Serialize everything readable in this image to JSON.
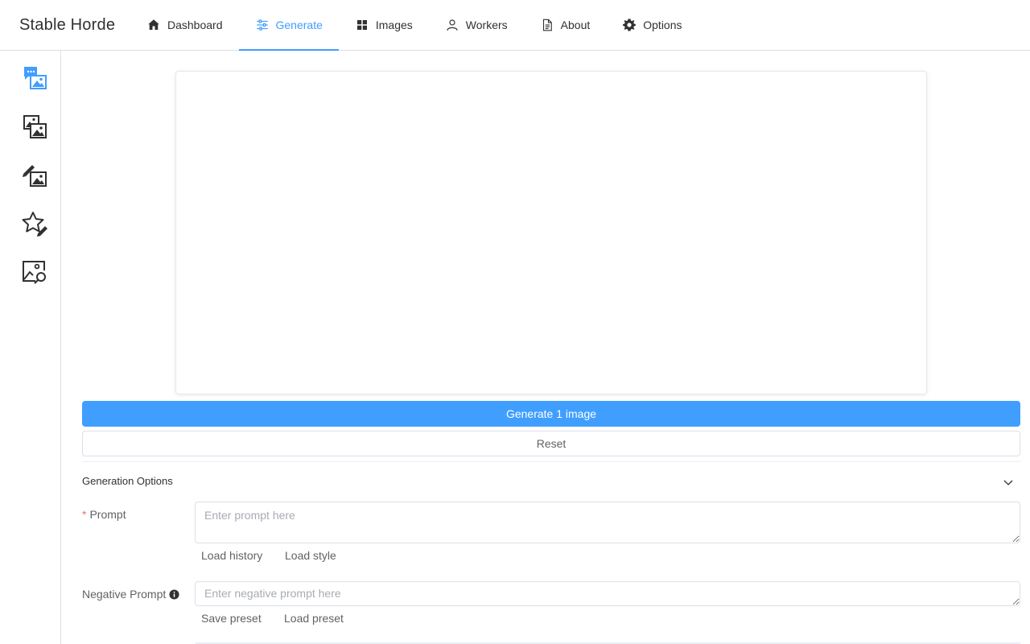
{
  "app": {
    "title": "Stable Horde"
  },
  "nav": {
    "items": [
      {
        "label": "Dashboard",
        "icon": "home-icon"
      },
      {
        "label": "Generate",
        "icon": "sliders-icon",
        "active": true
      },
      {
        "label": "Images",
        "icon": "grid-icon"
      },
      {
        "label": "Workers",
        "icon": "user-icon"
      },
      {
        "label": "About",
        "icon": "document-icon"
      },
      {
        "label": "Options",
        "icon": "gear-icon"
      }
    ]
  },
  "sidebar": {
    "items": [
      {
        "name": "text-to-image",
        "icon": "chat-image-icon",
        "active": true
      },
      {
        "name": "image-to-image",
        "icon": "images-icon"
      },
      {
        "name": "inpainting",
        "icon": "brush-image-icon"
      },
      {
        "name": "rate",
        "icon": "star-edit-icon"
      },
      {
        "name": "interrogation",
        "icon": "image-search-icon"
      }
    ]
  },
  "actions": {
    "generate_label": "Generate 1 image",
    "reset_label": "Reset"
  },
  "options": {
    "title": "Generation Options",
    "prompt": {
      "label": "Prompt",
      "required_mark": "*",
      "placeholder": "Enter prompt here",
      "load_history": "Load history",
      "load_style": "Load style"
    },
    "negative_prompt": {
      "label": "Negative Prompt",
      "placeholder": "Enter negative prompt here",
      "save_preset": "Save preset",
      "load_preset": "Load preset"
    }
  },
  "colors": {
    "accent": "#409eff",
    "required": "#f56c6c",
    "border": "#dcdfe6"
  }
}
